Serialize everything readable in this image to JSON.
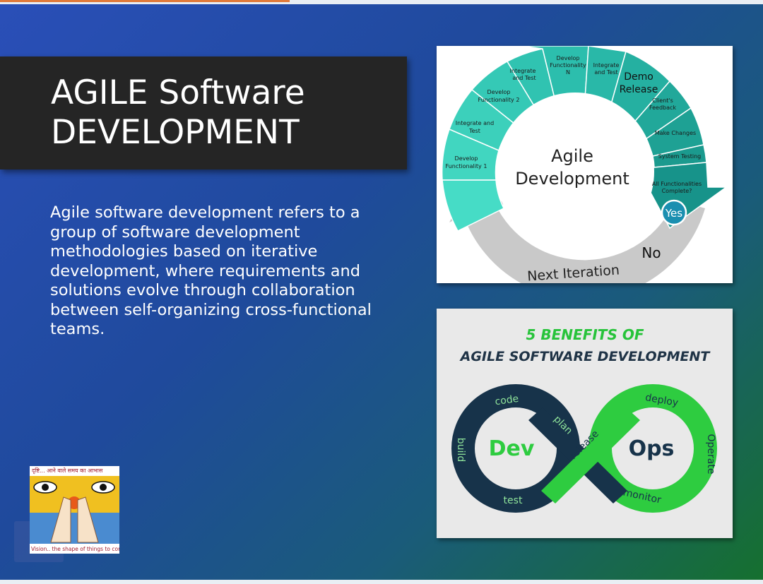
{
  "slide": {
    "title": "AGILE Software\nDEVELOPMENT",
    "body": "Agile software development refers to a group of software development methodologies based on iterative development, where requirements and solutions evolve through collaboration between self-organizing cross-functional teams."
  },
  "agile_cycle": {
    "center_line1": "Agile",
    "center_line2": "Development",
    "steps": [
      "Develop Functionality 1",
      "Integrate and Test",
      "Develop Functionality 2",
      "Integrate and Test",
      "Develop Functionality N",
      "Integrate and Test",
      "Demo Release",
      "Client's Feedback",
      "Make Changes",
      "System Testing",
      "All Functionalities Complete?"
    ],
    "yes_label": "Yes",
    "no_label": "No",
    "next_iteration": "Next Iteration"
  },
  "devops": {
    "heading1": "5 BENEFITS OF",
    "heading2": "AGILE SOFTWARE DEVELOPMENT",
    "dev": "Dev",
    "ops": "Ops",
    "loop_labels": [
      "code",
      "build",
      "test",
      "plan",
      "release",
      "deploy",
      "Operate",
      "monitor"
    ]
  },
  "logo": {
    "top_text": "दृष्टि... आने वाले समय का आभास",
    "bottom_text": "Vision.. the shape of things to come"
  },
  "colors": {
    "title_bg": "#252525",
    "teal": "#2bbfb0",
    "devops_green": "#2ecc40",
    "devops_navy": "#17334a"
  }
}
